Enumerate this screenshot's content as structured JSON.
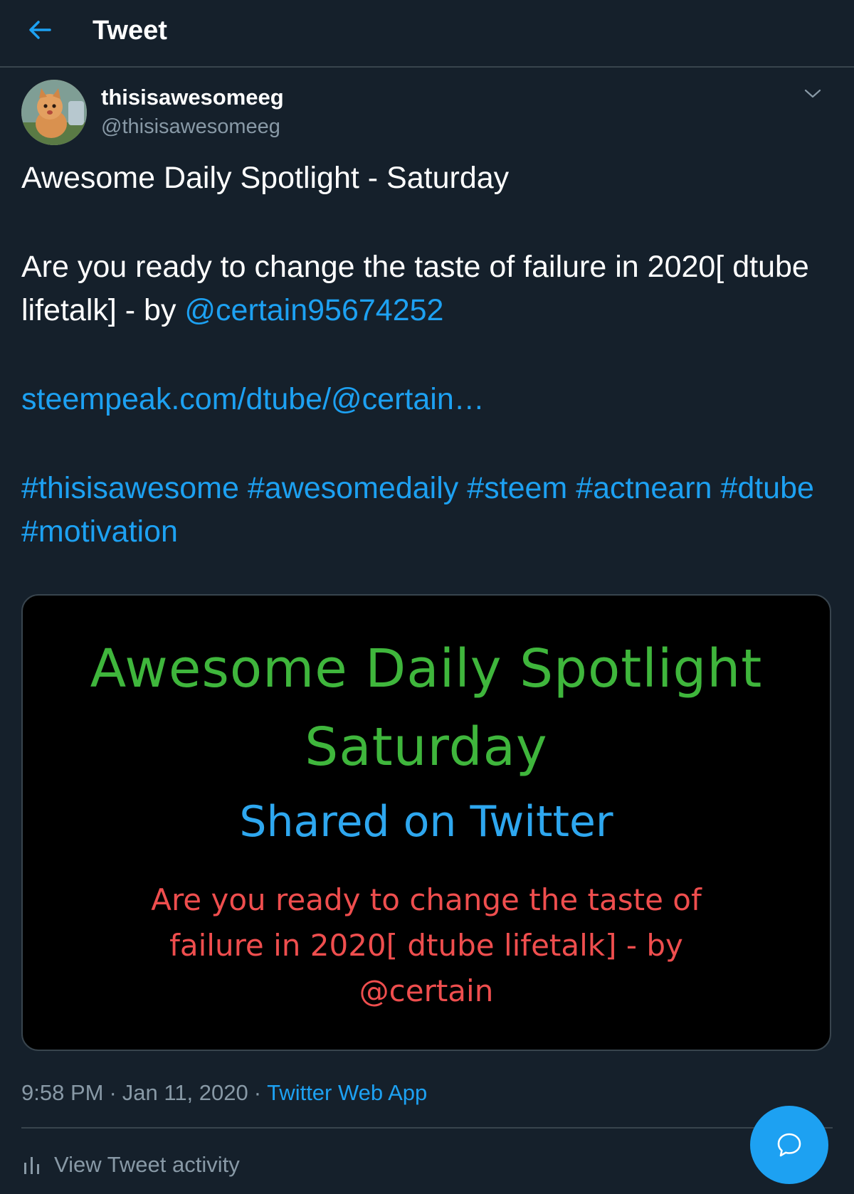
{
  "header": {
    "title": "Tweet",
    "back_icon": "arrow-left-icon"
  },
  "author": {
    "display_name": "thisisawesomeeg",
    "handle": "@thisisawesomeeg",
    "more_icon": "chevron-down-icon"
  },
  "tweet": {
    "line1": "Awesome Daily Spotlight - Saturday",
    "line2": "Are you ready to change the taste of failure in 2020[ dtube lifetalk] - by ",
    "mention": "@certain95674252",
    "link": "steempeak.com/dtube/@certain…",
    "hashtags": [
      "#thisisawesome",
      "#awesomedaily",
      "#steem",
      "#actnearn",
      "#dtube",
      "#motivation"
    ]
  },
  "media": {
    "title_line1": "Awesome Daily Spotlight",
    "title_line2": "Saturday",
    "subtitle": "Shared on Twitter",
    "desc_line1": "Are you ready to change the taste of",
    "desc_line2": "failure in 2020[ dtube lifetalk] - by",
    "desc_line3": "@certain"
  },
  "meta": {
    "time": "9:58 PM",
    "separator": "·",
    "date": "Jan 11, 2020",
    "source": "Twitter Web App"
  },
  "activity": {
    "label": "View Tweet activity",
    "icon": "bar-chart-icon"
  },
  "fab": {
    "icon": "reply-bubble-icon"
  },
  "colors": {
    "background": "#15202b",
    "accent": "#1da1f2",
    "secondary_text": "#8899a6",
    "border": "#38444d",
    "media_green": "#3fb63c",
    "media_blue": "#2ea7ef",
    "media_red": "#ef4e4e"
  }
}
